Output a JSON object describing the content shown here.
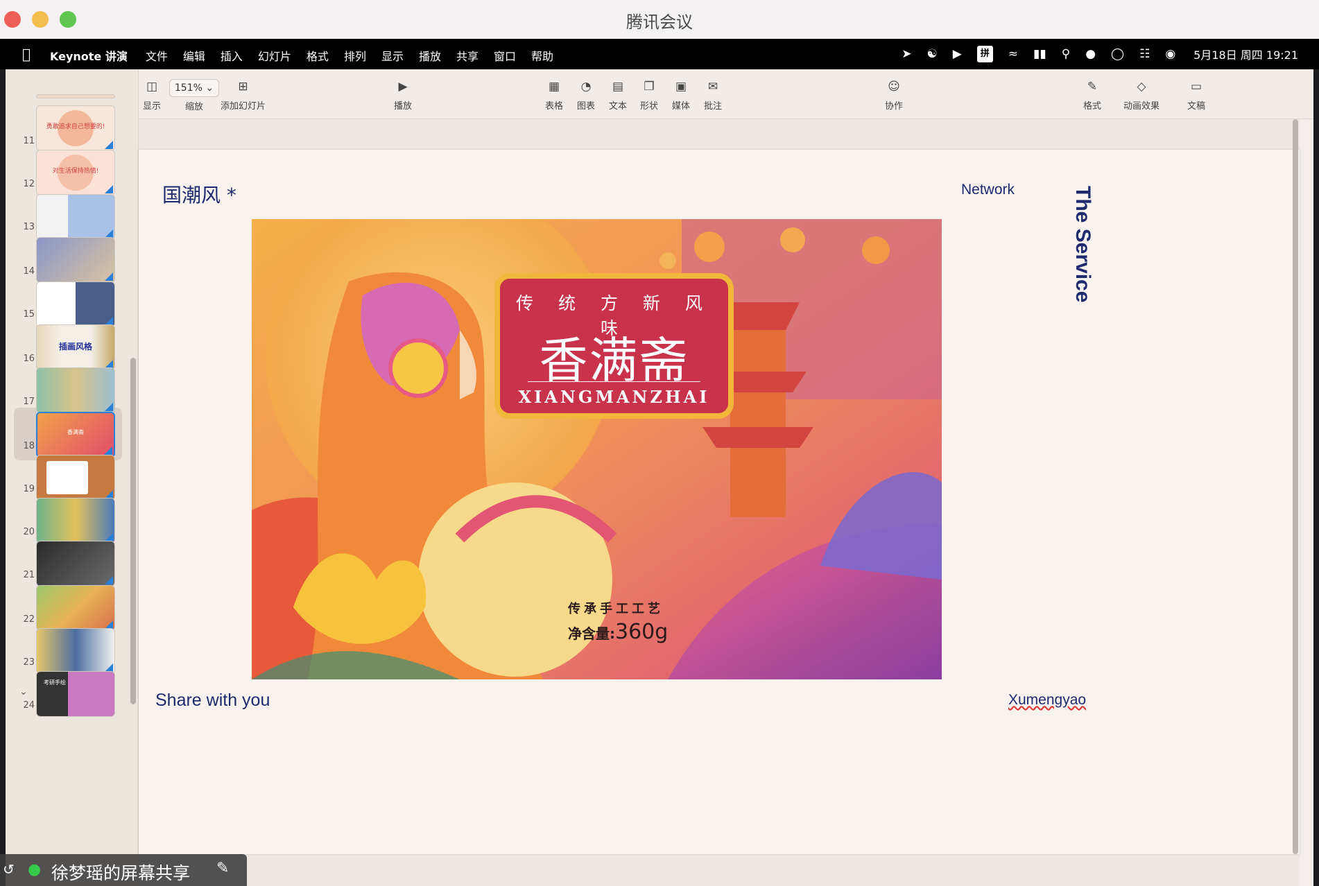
{
  "window": {
    "title": "腾讯会议"
  },
  "menubar": {
    "app_name": "Keynote 讲演",
    "items": [
      "文件",
      "编辑",
      "插入",
      "幻灯片",
      "格式",
      "排列",
      "显示",
      "播放",
      "共享",
      "窗口",
      "帮助"
    ],
    "ime": "拼",
    "clock": "5月18日 周四  19:21"
  },
  "toolbar": {
    "view": "显示",
    "zoom_value": "151%",
    "zoom": "缩放",
    "add_slide": "添加幻灯片",
    "play": "播放",
    "table": "表格",
    "chart": "图表",
    "text": "文本",
    "shape": "形状",
    "media": "媒体",
    "comment": "批注",
    "collaborate": "协作",
    "format": "格式",
    "animate": "动画效果",
    "document": "文稿"
  },
  "navigator": {
    "slides": [
      {
        "num": "11",
        "label": "勇敢追求自己想要的!"
      },
      {
        "num": "12",
        "label": "对生活保持热情!"
      },
      {
        "num": "13",
        "label": ""
      },
      {
        "num": "14",
        "label": ""
      },
      {
        "num": "15",
        "label": ""
      },
      {
        "num": "16",
        "label": "插画风格"
      },
      {
        "num": "17",
        "label": ""
      },
      {
        "num": "18",
        "label": "香满斋"
      },
      {
        "num": "19",
        "label": ""
      },
      {
        "num": "20",
        "label": ""
      },
      {
        "num": "21",
        "label": ""
      },
      {
        "num": "22",
        "label": ""
      },
      {
        "num": "23",
        "label": ""
      },
      {
        "num": "24",
        "label": "考研手绘"
      }
    ],
    "selected": "18"
  },
  "slide": {
    "title": "国潮风 *",
    "network": "Network",
    "vertical": "The Service",
    "share": "Share with you",
    "author": "Xumengyao",
    "art": {
      "tagline": "传 统 方 新 风 味",
      "brand": "香满斋",
      "brand_en": "XIANGMANZHAI",
      "craft": "传承手工工艺",
      "weight_label": "净含量:",
      "weight_value": "360g"
    }
  },
  "share_banner": {
    "text": "徐梦瑶的屏幕共享"
  },
  "colors": {
    "accent": "#1f2a6e",
    "plaque": "#c8324b",
    "selection": "#2a7fd8"
  }
}
